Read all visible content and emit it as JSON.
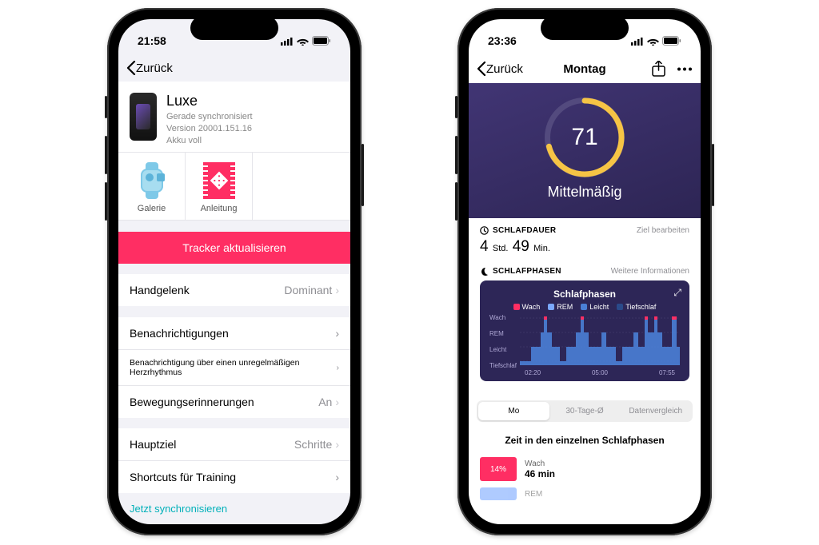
{
  "left": {
    "status_time": "21:58",
    "nav_back": "Zurück",
    "device": {
      "name": "Luxe",
      "sync": "Gerade synchronisiert",
      "version": "Version 20001.151.16",
      "battery": "Akku voll"
    },
    "tile_gallery": "Galerie",
    "tile_guide": "Anleitung",
    "update_button": "Tracker aktualisieren",
    "rows": {
      "wrist_label": "Handgelenk",
      "wrist_value": "Dominant",
      "notifications": "Benachrichtigungen",
      "irregular": "Benachrichtigung über einen unregelmäßigen Herzrhythmus",
      "reminders_label": "Bewegungserinnerungen",
      "reminders_value": "An",
      "goal_label": "Hauptziel",
      "goal_value": "Schritte",
      "shortcuts": "Shortcuts für Training"
    },
    "sync_now": "Jetzt synchronisieren"
  },
  "right": {
    "status_time": "23:36",
    "nav_back": "Zurück",
    "nav_title": "Montag",
    "hero": {
      "score": "71",
      "label": "Mittelmäßig"
    },
    "duration": {
      "title": "SCHLAFDAUER",
      "edit": "Ziel bearbeiten",
      "hours": "4",
      "hours_unit": "Std.",
      "minutes": "49",
      "minutes_unit": "Min."
    },
    "phases": {
      "title": "SCHLAFPHASEN",
      "more": "Weitere Informationen",
      "card_title": "Schlafphasen",
      "legend": {
        "wach": "Wach",
        "rem": "REM",
        "leicht": "Leicht",
        "tief": "Tiefschlaf"
      },
      "ylabels": {
        "wach": "Wach",
        "rem": "REM",
        "leicht": "Leicht",
        "tief": "Tiefschlaf"
      },
      "xticks": {
        "a": "02:20",
        "b": "05:00",
        "c": "07:55"
      }
    },
    "segments": {
      "mo": "Mo",
      "thirty": "30-Tage-Ø",
      "compare": "Datenvergleich"
    },
    "section_title": "Zeit in den einzelnen Schlafphasen",
    "phase_rows": {
      "wach": {
        "pct": "14%",
        "label": "Wach",
        "dur": "46 min"
      },
      "rem": {
        "pct": "",
        "label": "REM",
        "dur": ""
      }
    }
  },
  "chart_data": {
    "type": "area",
    "title": "Schlafphasen",
    "categories": [
      "Wach",
      "REM",
      "Leicht",
      "Tiefschlaf"
    ],
    "x_range": [
      "02:20",
      "07:55"
    ],
    "xticks": [
      "02:20",
      "05:00",
      "07:55"
    ],
    "series": [
      {
        "name": "Schlafphase",
        "stage_by_time": [
          "Leicht",
          "Tiefschlaf",
          "Leicht",
          "REM",
          "Wach",
          "Leicht",
          "Tiefschlaf",
          "Leicht",
          "REM",
          "Wach",
          "Leicht",
          "REM",
          "Leicht",
          "Tiefschlaf",
          "Leicht",
          "REM",
          "Leicht",
          "Wach",
          "REM",
          "Wach",
          "REM",
          "Leicht",
          "Wach"
        ]
      }
    ],
    "legend": [
      "Wach",
      "REM",
      "Leicht",
      "Tiefschlaf"
    ]
  }
}
